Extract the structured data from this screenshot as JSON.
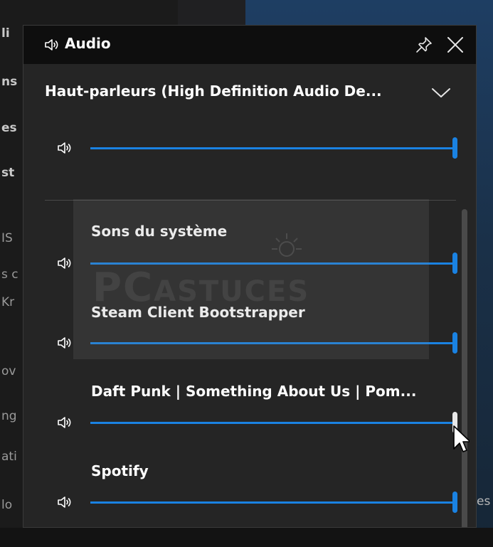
{
  "background": {
    "left_fragments": [
      "li",
      "ns",
      "es",
      "st",
      "IS",
      "s c",
      "Kr",
      "ov",
      "ng",
      "ati",
      "lo"
    ],
    "right_fragment": "es"
  },
  "panel": {
    "title": "Audio",
    "title_icon": "speaker-icon",
    "pin_icon": "pin-icon",
    "close_icon": "close-icon"
  },
  "device": {
    "name": "Haut-parleurs (High Definition Audio De...",
    "chevron_icon": "chevron-down-icon",
    "volume": 1.0
  },
  "apps": [
    {
      "label": "Sons du système",
      "volume": 1.0
    },
    {
      "label": "Steam Client Bootstrapper",
      "volume": 1.0
    },
    {
      "label": "Daft Punk | Something About Us | Pom...",
      "volume": 1.0
    },
    {
      "label": "Spotify",
      "volume": 1.0
    }
  ],
  "watermark": {
    "text_big": "PC",
    "text_small": "ASTUCES"
  },
  "colors": {
    "accent": "#1a82e2",
    "panel_bg": "#252525",
    "titlebar_bg": "#0e0e0e",
    "track": "#5a5a5a",
    "thumb_hover": "#e8e8e8"
  }
}
